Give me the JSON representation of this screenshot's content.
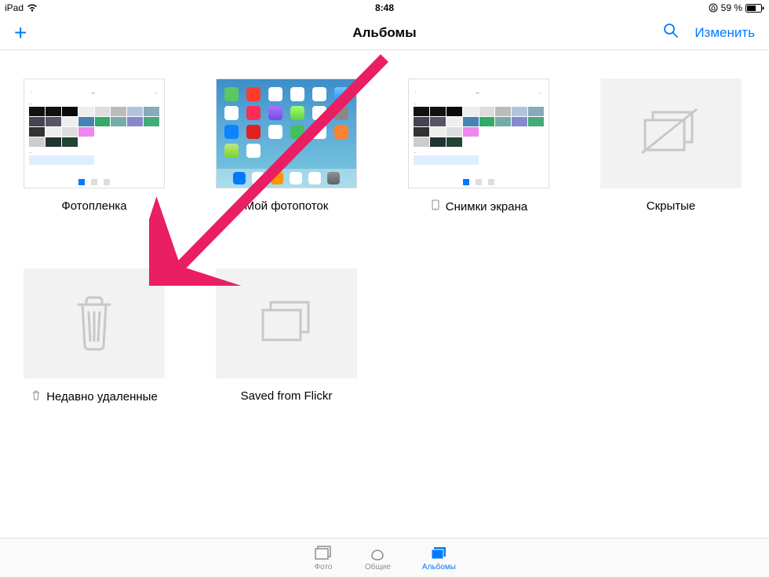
{
  "status": {
    "device": "iPad",
    "time": "8:48",
    "battery_text": "59 %"
  },
  "nav": {
    "title": "Альбомы",
    "edit": "Изменить"
  },
  "albums": [
    {
      "label": "Фотопленка"
    },
    {
      "label": "Мой фотопоток"
    },
    {
      "label": "Снимки экрана"
    },
    {
      "label": "Скрытые"
    },
    {
      "label": "Недавно удаленные"
    },
    {
      "label": "Saved from Flickr"
    }
  ],
  "tabs": {
    "photos": "Фото",
    "shared": "Общие",
    "albums": "Альбомы"
  }
}
